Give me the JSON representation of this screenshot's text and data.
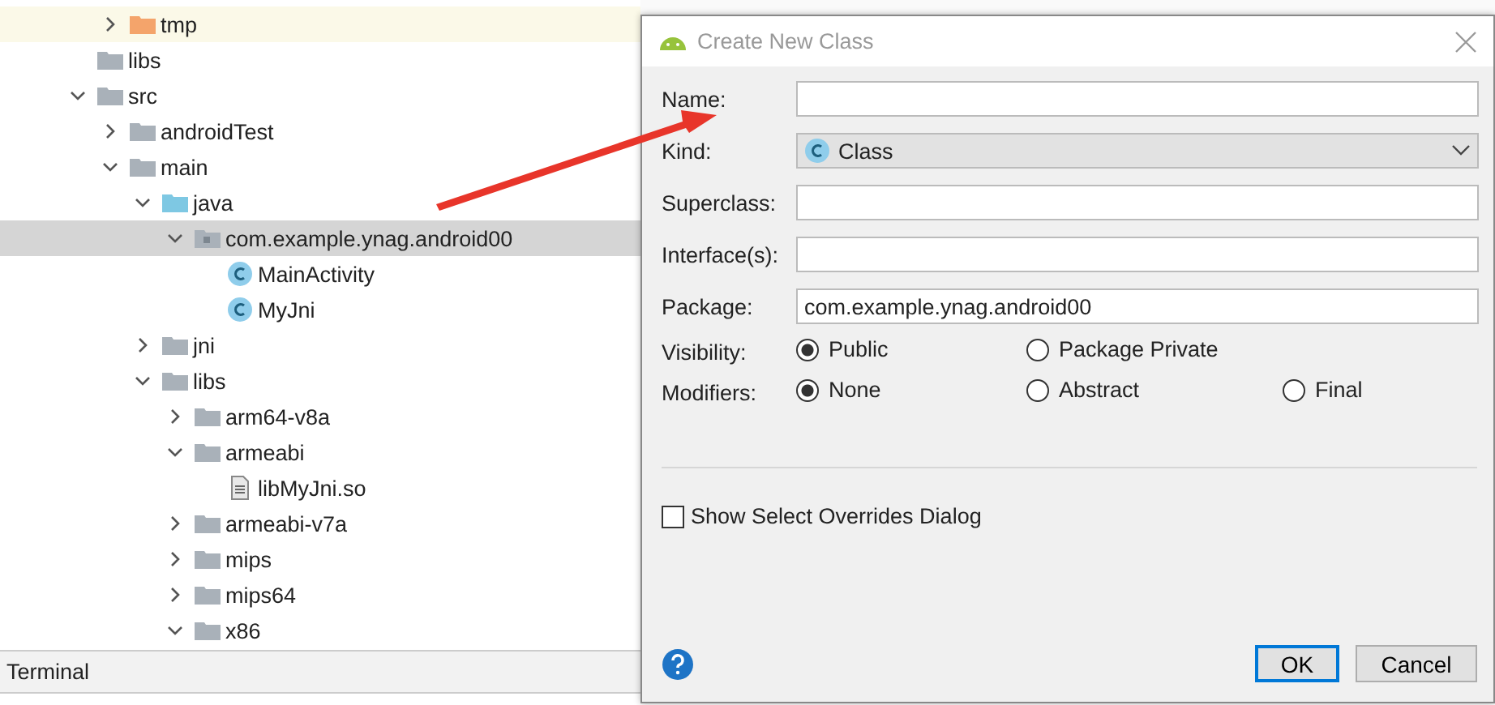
{
  "project_tree": {
    "partial_parent_children": [
      {
        "label": "tmp",
        "kind": "excluded",
        "expanded": false,
        "selected": false
      }
    ],
    "items": [
      {
        "label": "libs",
        "kind": "folder",
        "selected": false
      },
      {
        "label": "src",
        "kind": "folder",
        "expanded": true,
        "selected": false,
        "children": [
          {
            "label": "androidTest",
            "kind": "folder",
            "expanded": false,
            "selected": false
          },
          {
            "label": "main",
            "kind": "folder",
            "expanded": true,
            "selected": false,
            "children": [
              {
                "label": "java",
                "kind": "source",
                "expanded": true,
                "selected": false,
                "children": [
                  {
                    "label": "com.example.ynag.android00",
                    "kind": "package",
                    "expanded": true,
                    "selected": true,
                    "children": [
                      {
                        "label": "MainActivity",
                        "kind": "class",
                        "selected": false
                      },
                      {
                        "label": "MyJni",
                        "kind": "class",
                        "selected": false
                      }
                    ]
                  }
                ]
              },
              {
                "label": "jni",
                "kind": "folder",
                "expanded": false,
                "selected": false
              },
              {
                "label": "libs",
                "kind": "folder",
                "expanded": true,
                "selected": false,
                "children": [
                  {
                    "label": "arm64-v8a",
                    "kind": "folder",
                    "expanded": false,
                    "selected": false
                  },
                  {
                    "label": "armeabi",
                    "kind": "folder",
                    "expanded": true,
                    "selected": false,
                    "children": [
                      {
                        "label": "libMyJni.so",
                        "kind": "file",
                        "selected": false
                      }
                    ]
                  },
                  {
                    "label": "armeabi-v7a",
                    "kind": "folder",
                    "expanded": false,
                    "selected": false
                  },
                  {
                    "label": "mips",
                    "kind": "folder",
                    "expanded": false,
                    "selected": false
                  },
                  {
                    "label": "mips64",
                    "kind": "folder",
                    "expanded": false,
                    "selected": false
                  },
                  {
                    "label": "x86",
                    "kind": "folder",
                    "expanded": true,
                    "selected": false
                  }
                ]
              }
            ]
          }
        ]
      }
    ]
  },
  "bottom_bar": {
    "tab": "Terminal"
  },
  "dialog": {
    "title": "Create New Class",
    "fields": [
      {
        "kind": "text",
        "label": "Name:"
      },
      {
        "kind": "dropdown",
        "label": "Kind:",
        "value": "Class"
      },
      {
        "kind": "text",
        "label": "Superclass:"
      },
      {
        "kind": "text",
        "label": "Interface(s):"
      },
      {
        "kind": "text",
        "label": "Package:",
        "value": "com.example.ynag.android00"
      },
      {
        "kind": "radio",
        "label": "Visibility:",
        "options": [
          {
            "label": "Public",
            "selected": true
          },
          {
            "label": "Package Private",
            "selected": false
          }
        ]
      },
      {
        "kind": "radio",
        "label": "Modifiers:",
        "options": [
          {
            "label": "None",
            "selected": true
          },
          {
            "label": "Abstract",
            "selected": false
          },
          {
            "label": "Final",
            "selected": false
          }
        ]
      }
    ],
    "checkbox": {
      "label": "Show Select Overrides Dialog",
      "checked": false
    },
    "buttons": [
      {
        "label": "OK",
        "default": true
      },
      {
        "label": "Cancel",
        "default": false
      }
    ]
  }
}
